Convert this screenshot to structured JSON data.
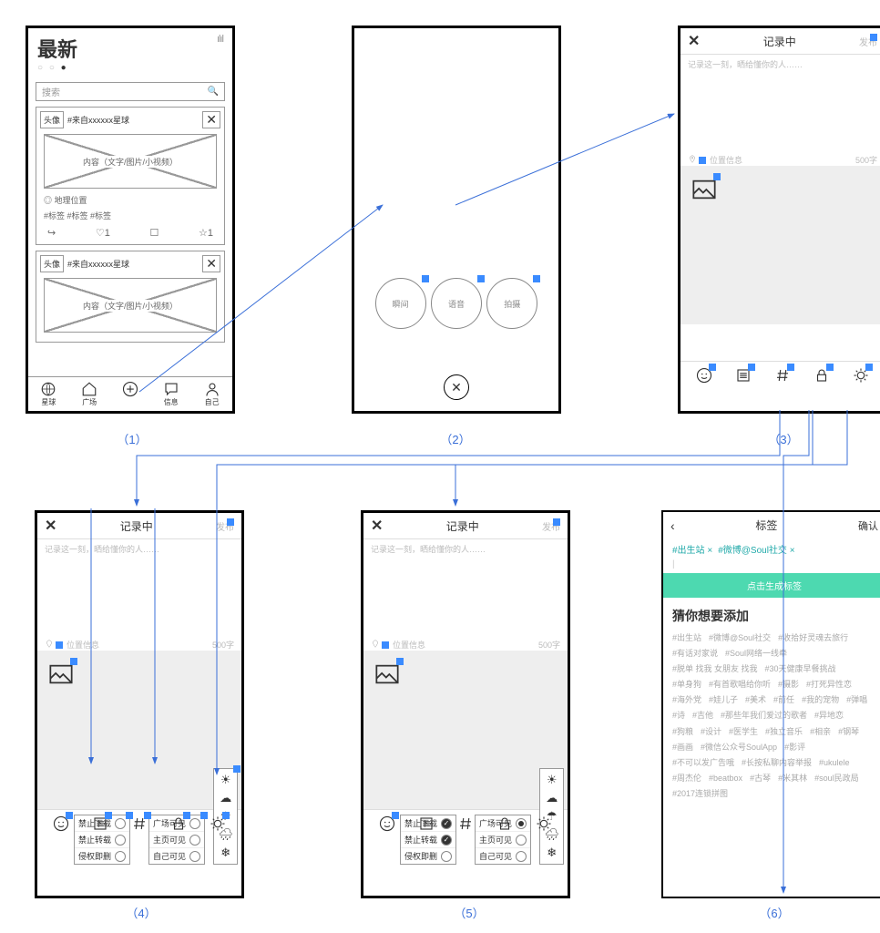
{
  "captions": {
    "c1": "（1）",
    "c2": "（2）",
    "c3": "（3）",
    "c4": "（4）",
    "c5": "（5）",
    "c6": "（6）"
  },
  "s1": {
    "title": "最新",
    "search": "搜索",
    "card": {
      "avatar": "头像",
      "source": "#来自xxxxxx星球",
      "content": "内容（文字/图片/小视频）",
      "geo": "◎ 地理位置",
      "tags": "#标签   #标签   #标签",
      "like": "1",
      "star": "1"
    },
    "tabs": {
      "t1": "星球",
      "t2": "广场",
      "t3": "",
      "t4": "信息",
      "t5": "自己"
    }
  },
  "s2": {
    "b1": "瞬间",
    "b2": "语音",
    "b3": "拍摄"
  },
  "edit": {
    "title": "记录中",
    "publish": "发布",
    "placeholder": "记录这一刻，晒给懂你的人……",
    "loc": "位置信息",
    "count": "500字"
  },
  "s4": {
    "left": {
      "o1": "禁止下载",
      "o2": "禁止转载",
      "o3": "侵权即删"
    },
    "right": {
      "o1": "广场可见",
      "o2": "主页可见",
      "o3": "自己可见"
    }
  },
  "s6": {
    "title": "标签",
    "ok": "确认",
    "sel": {
      "t1": "#出生站 ×",
      "t2": "#微博@Soul社交 ×"
    },
    "gen": "点击生成标签",
    "guess": "猜你想要添加",
    "tags": [
      "#出生站",
      "#微博@Soul社交",
      "#收拾好灵魂去旅行",
      "#有话对家说",
      "#Soul网络一线牵",
      "#脱单 找我 女朋友 找我",
      "#30天健康早餐挑战",
      "#单身狗",
      "#有首歌唱给你听",
      "#摄影",
      "#打死异性恋",
      "#海外党",
      "#娃儿子",
      "#美术",
      "#前任",
      "#我的宠物",
      "#弹唱",
      "#诗",
      "#吉他",
      "#那些年我们爱过的歌者",
      "#异地恋",
      "#狗粮",
      "#设计",
      "#医学生",
      "#独立音乐",
      "#相亲",
      "#钢琴",
      "#画画",
      "#微信公众号SoulApp",
      "#影评",
      "#不可以发广告哦",
      "#长按私聊内容举报",
      "#ukulele",
      "#周杰伦",
      "#beatbox",
      "#古琴",
      "#米其林",
      "#soul民政局",
      "#2017连锁拼图"
    ]
  }
}
